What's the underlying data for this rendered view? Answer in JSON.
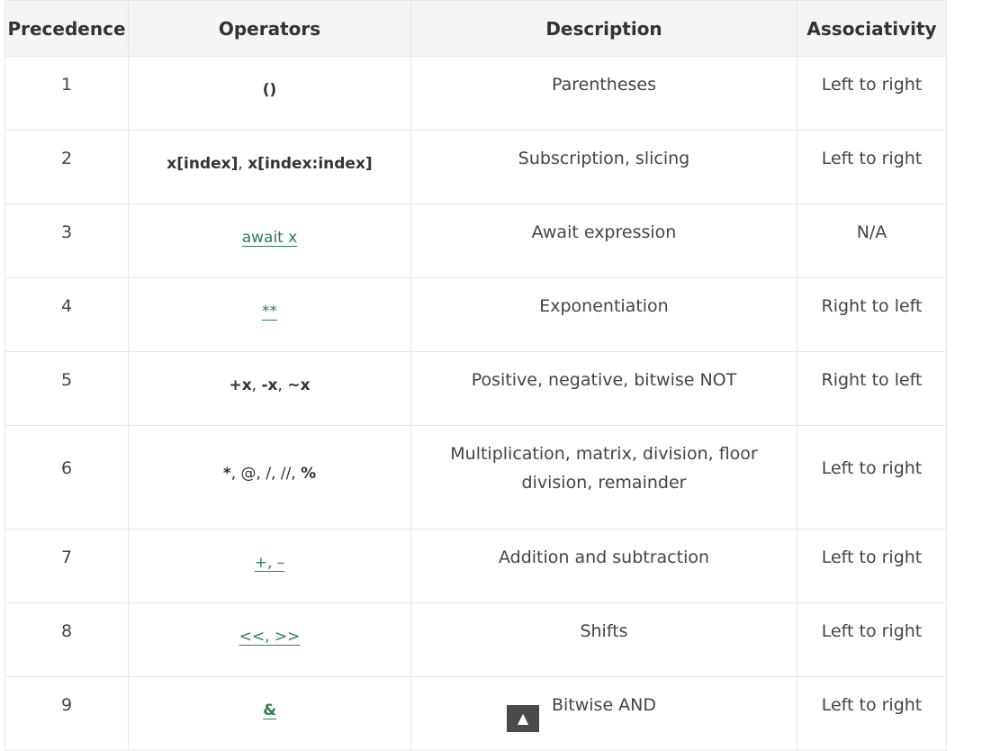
{
  "headers": [
    "Precedence",
    "Operators",
    "Description",
    "Associativity"
  ],
  "rows": [
    {
      "precedence": "1",
      "operators": [
        {
          "text": "()",
          "style": "bold"
        }
      ],
      "description": "Parentheses",
      "associativity": "Left to right"
    },
    {
      "precedence": "2",
      "operators": [
        {
          "text": "x[index]",
          "style": "bold"
        },
        {
          "text": ", ",
          "style": "plain"
        },
        {
          "text": "x[index:index]",
          "style": "bold"
        }
      ],
      "description": "Subscription, slicing",
      "associativity": "Left to right"
    },
    {
      "precedence": "3",
      "operators": [
        {
          "text": "await x",
          "style": "link"
        }
      ],
      "description": "Await expression",
      "associativity": "N/A"
    },
    {
      "precedence": "4",
      "operators": [
        {
          "text": "**",
          "style": "link"
        }
      ],
      "description": "Exponentiation",
      "associativity": "Right to left"
    },
    {
      "precedence": "5",
      "operators": [
        {
          "text": "+x",
          "style": "bold"
        },
        {
          "text": ", ",
          "style": "plain"
        },
        {
          "text": "-x",
          "style": "bold"
        },
        {
          "text": ", ",
          "style": "plain"
        },
        {
          "text": "~x",
          "style": "bold"
        }
      ],
      "description": "Positive, negative, bitwise NOT",
      "associativity": "Right to left"
    },
    {
      "precedence": "6",
      "operators": [
        {
          "text": "*",
          "style": "bold"
        },
        {
          "text": ", @, /, //, ",
          "style": "plain"
        },
        {
          "text": "%",
          "style": "bold"
        }
      ],
      "description": "Multiplication, matrix, division, floor division, remainder",
      "associativity": "Left to right"
    },
    {
      "precedence": "7",
      "operators": [
        {
          "text": "+, –",
          "style": "link"
        }
      ],
      "description": "Addition and subtraction",
      "associativity": "Left to right"
    },
    {
      "precedence": "8",
      "operators": [
        {
          "text": "<<, >>",
          "style": "link"
        }
      ],
      "description": "Shifts",
      "associativity": "Left to right"
    },
    {
      "precedence": "9",
      "operators": [
        {
          "text": "&",
          "style": "linkbold"
        }
      ],
      "description": "Bitwise AND",
      "associativity": "Left to right"
    }
  ],
  "scroll_top": {
    "icon": "triangle-up-icon",
    "glyph": "▲"
  }
}
